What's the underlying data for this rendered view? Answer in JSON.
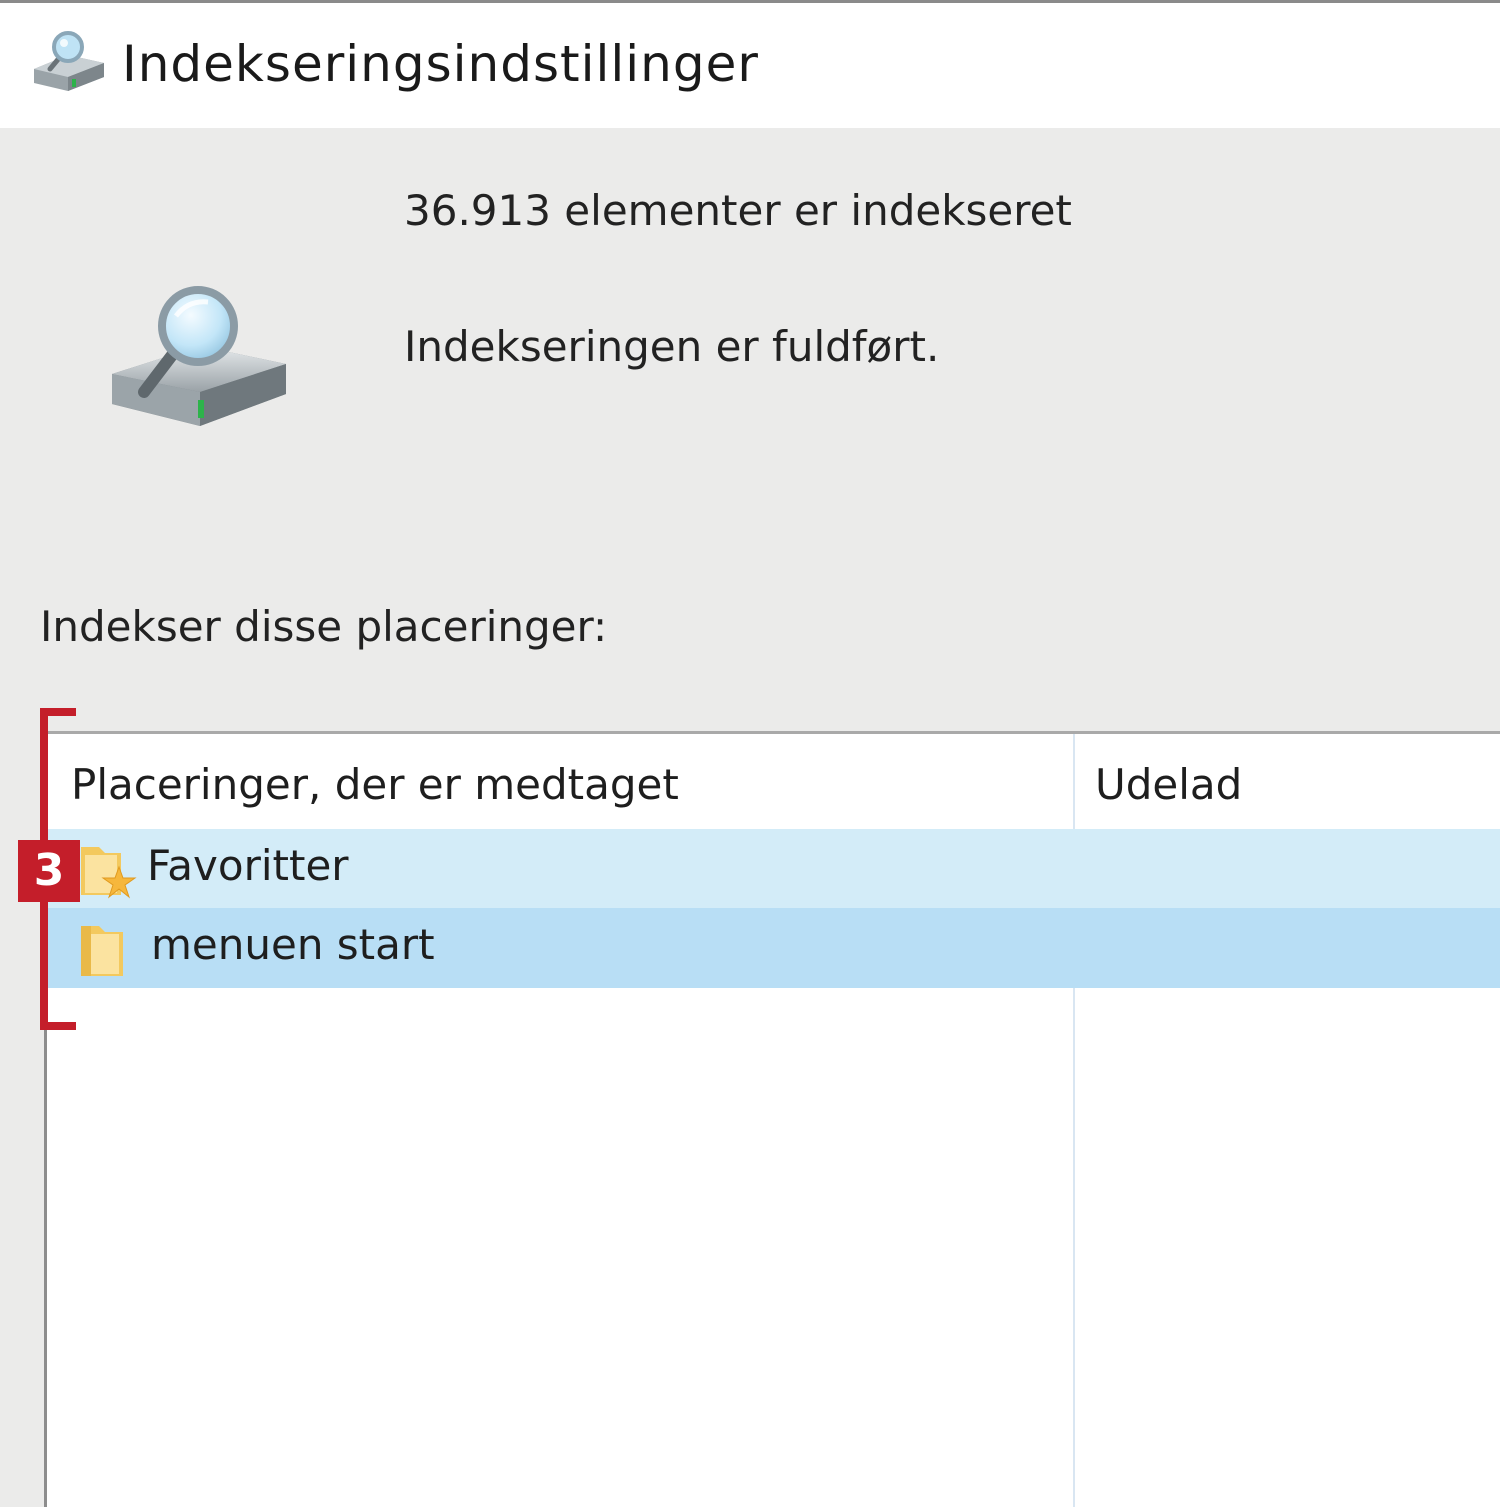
{
  "window": {
    "title": "Indekseringsindstillinger",
    "title_icon": "indexing-drive-icon"
  },
  "status": {
    "count_text": "36.913 elementer er indekseret",
    "status_text": "Indekseringen er fuldført.",
    "icon": "drive-magnifier-icon"
  },
  "locations": {
    "label": "Indekser disse placeringer:",
    "columns": [
      "Placeringer, der er medtaget",
      "Udelad"
    ],
    "rows": [
      {
        "name": "Favoritter",
        "icon": "favorites-folder-icon"
      },
      {
        "name": "menuen start",
        "icon": "folder-icon"
      }
    ]
  },
  "annotation": {
    "badge": "3",
    "color": "#c41e2a"
  }
}
